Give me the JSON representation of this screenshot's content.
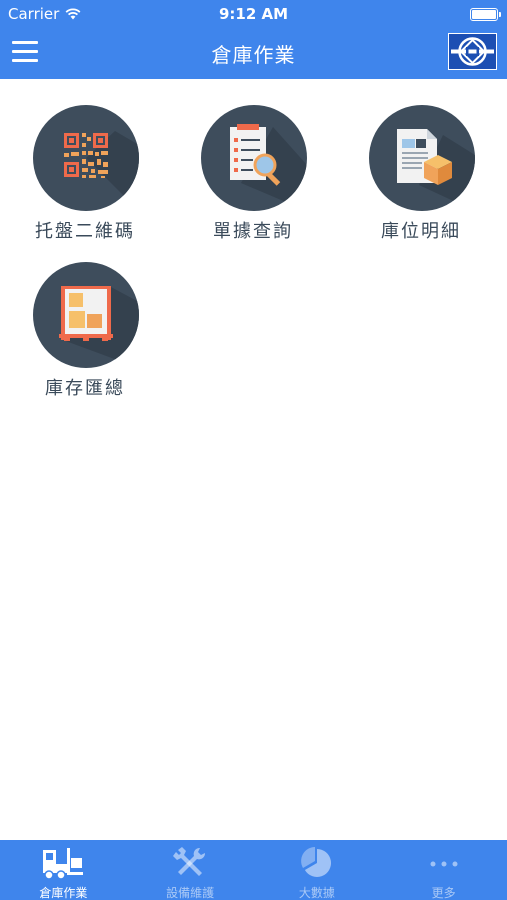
{
  "status_bar": {
    "carrier": "Carrier",
    "time": "9:12 AM",
    "battery_level": 1.0
  },
  "nav": {
    "title": "倉庫作業",
    "menu_icon": "hamburger-menu-icon",
    "logo_icon": "company-logo-icon"
  },
  "tiles": [
    {
      "label": "托盤二維碼",
      "icon": "qr-code-icon"
    },
    {
      "label": "單據查詢",
      "icon": "document-search-icon"
    },
    {
      "label": "庫位明細",
      "icon": "document-box-icon"
    },
    {
      "label": "庫存匯總",
      "icon": "pallet-stack-icon"
    }
  ],
  "tab_bar": {
    "active_index": 0,
    "tabs": [
      {
        "label": "倉庫作業",
        "icon": "forklift-icon"
      },
      {
        "label": "設備維護",
        "icon": "tools-icon"
      },
      {
        "label": "大數據",
        "icon": "pie-chart-icon"
      },
      {
        "label": "更多",
        "icon": "more-dots-icon"
      }
    ]
  },
  "colors": {
    "primary": "#3f85ec",
    "tile_circle": "#3e4d5c",
    "label_text": "#3a4a5a",
    "accent_orange": "#f0a35a"
  }
}
